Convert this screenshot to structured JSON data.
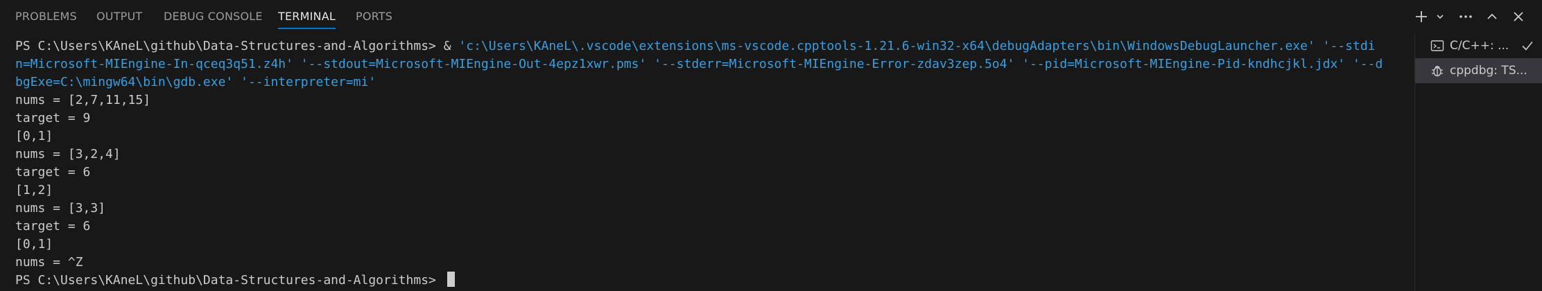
{
  "tabs": [
    {
      "label": "PROBLEMS"
    },
    {
      "label": "OUTPUT"
    },
    {
      "label": "DEBUG CONSOLE"
    },
    {
      "label": "TERMINAL",
      "active": true
    },
    {
      "label": "PORTS"
    }
  ],
  "terminal": {
    "prompt": "PS C:\\Users\\KAneL\\github\\Data-Structures-and-Algorithms>",
    "command_amp": " & ",
    "command_lines": [
      "'c:\\Users\\KAneL\\.vscode\\extensions\\ms-vscode.cpptools-1.21.6-win32-x64\\debugAdapters\\bin\\WindowsDebugLauncher.exe' '--stdi",
      "n=Microsoft-MIEngine-In-qceq3q51.z4h' '--stdout=Microsoft-MIEngine-Out-4epz1xwr.pms' '--stderr=Microsoft-MIEngine-Error-zdav3zep.5o4' '--pid=Microsoft-MIEngine-Pid-kndhcjkl.jdx' '--d",
      "bgExe=C:\\mingw64\\bin\\gdb.exe' '--interpreter=mi'"
    ],
    "output_lines": [
      "nums = [2,7,11,15]",
      "target = 9",
      "[0,1]",
      "nums = [3,2,4]",
      "target = 6",
      "[1,2]",
      "nums = [3,3]",
      "target = 6",
      "[0,1]",
      "nums = ^Z"
    ],
    "final_prompt": "PS C:\\Users\\KAneL\\github\\Data-Structures-and-Algorithms>"
  },
  "terminal_list": [
    {
      "label": "C/C++: ...",
      "icon": "terminal-icon",
      "checked": true
    },
    {
      "label": "cppdbg: TS...",
      "icon": "debug-icon",
      "selected": true
    }
  ],
  "icons": {
    "new_terminal": "plus-icon",
    "dropdown": "chevron-down-icon",
    "more": "ellipsis-icon",
    "maximize": "chevron-up-icon",
    "close": "close-icon"
  },
  "colors": {
    "background": "#181818",
    "text": "#cccccc",
    "command": "#3b9ee0",
    "accent": "#0078d4"
  }
}
